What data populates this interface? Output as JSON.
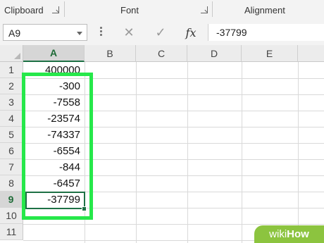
{
  "ribbon": {
    "groups": [
      {
        "label": "Clipboard"
      },
      {
        "label": "Font"
      },
      {
        "label": "Alignment"
      }
    ]
  },
  "formula_bar": {
    "name_box": "A9",
    "cancel_icon": "✕",
    "enter_icon": "✓",
    "fx_label": "fx",
    "value": "-37799"
  },
  "sheet": {
    "columns": [
      "A",
      "B",
      "C",
      "D",
      "E"
    ],
    "selected_column": "A",
    "rows": [
      "1",
      "2",
      "3",
      "4",
      "5",
      "6",
      "7",
      "8",
      "9",
      "10",
      "11"
    ],
    "selected_row": "9",
    "column_a_values": [
      "400000",
      "-300",
      "-7558",
      "-23574",
      "-74337",
      "-6554",
      "-844",
      "-6457",
      "-37799",
      "",
      ""
    ]
  },
  "watermark": {
    "prefix": "wiki",
    "suffix": "How"
  },
  "colors": {
    "highlight": "#26e84a",
    "excel_green": "#1e7145",
    "watermark_bg": "#8cc43f"
  }
}
